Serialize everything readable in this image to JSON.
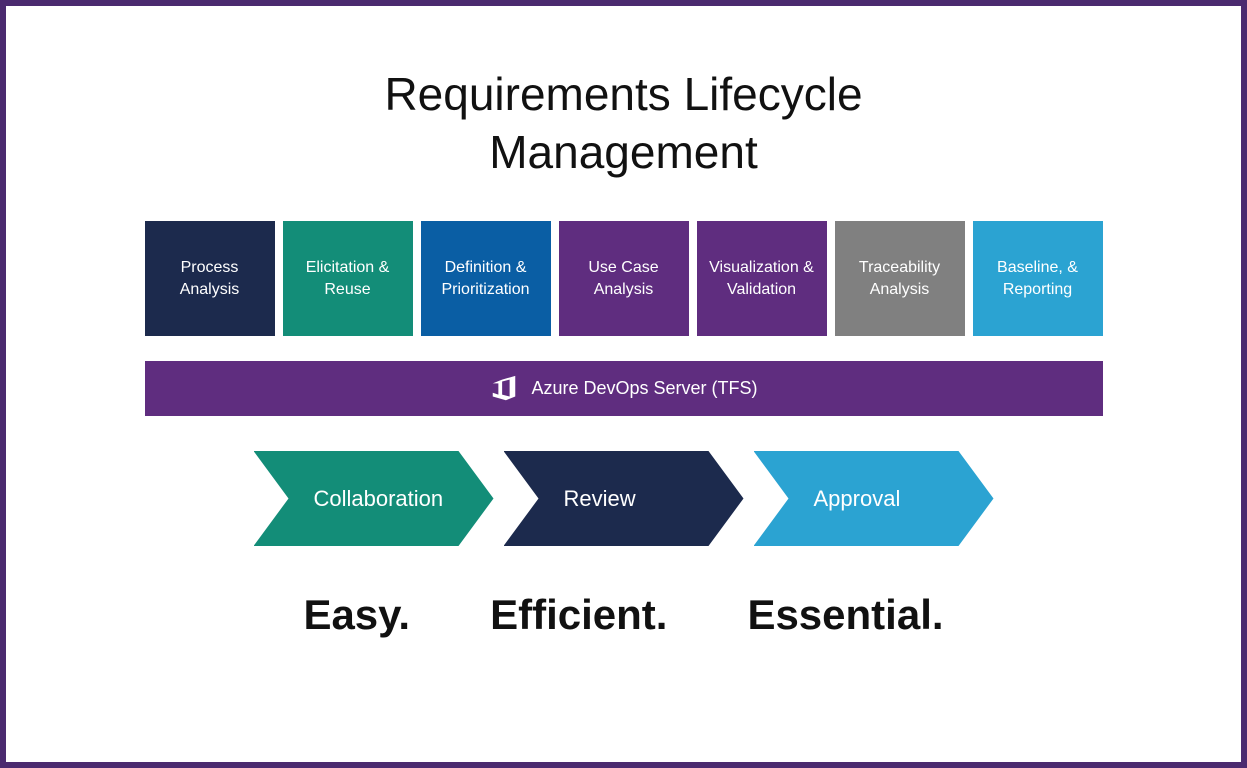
{
  "title": "Requirements Lifecycle\nManagement",
  "tiles": [
    {
      "label": "Process Analysis",
      "color": "#1c2a4d"
    },
    {
      "label": "Elicitation & Reuse",
      "color": "#138d78"
    },
    {
      "label": "Definition & Prioritization",
      "color": "#0a5ea4"
    },
    {
      "label": "Use Case Analysis",
      "color": "#5f2d7f"
    },
    {
      "label": "Visualization & Validation",
      "color": "#5f2d7f"
    },
    {
      "label": "Traceability Analysis",
      "color": "#808080"
    },
    {
      "label": "Baseline, & Reporting",
      "color": "#2ba3d2"
    }
  ],
  "platform": {
    "label": "Azure DevOps Server (TFS)",
    "color": "#5f2d7f",
    "icon": "azure-devops-icon"
  },
  "chevrons": [
    {
      "label": "Collaboration",
      "color": "#138d78"
    },
    {
      "label": "Review",
      "color": "#1c2a4d"
    },
    {
      "label": "Approval",
      "color": "#2ba3d2"
    }
  ],
  "taglines": [
    "Easy.",
    "Efficient.",
    "Essential."
  ],
  "colors": {
    "frame_border": "#4b2a6f"
  }
}
